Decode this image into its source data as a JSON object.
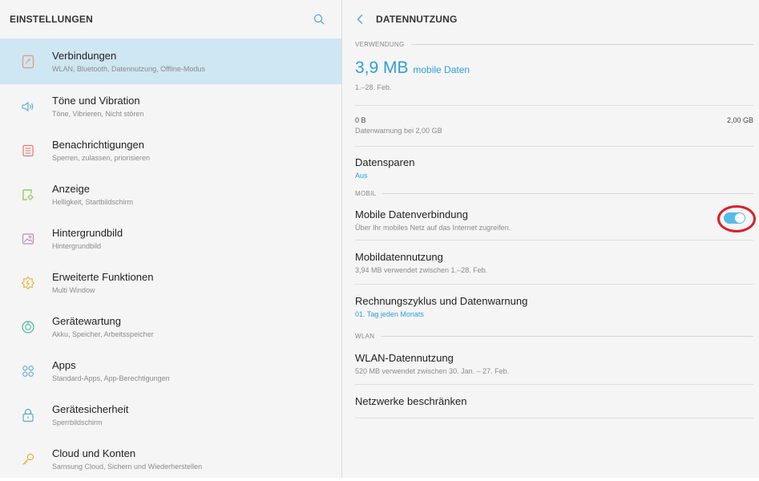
{
  "left": {
    "title": "EINSTELLUNGEN",
    "items": [
      {
        "title": "Verbindungen",
        "sub": "WLAN, Bluetooth, Datennutzung, Offline-Modus",
        "icon": "connections-icon"
      },
      {
        "title": "Töne und Vibration",
        "sub": "Töne, Vibrieren, Nicht stören",
        "icon": "speaker-icon"
      },
      {
        "title": "Benachrichtigungen",
        "sub": "Sperren, zulassen, priorisieren",
        "icon": "notifications-icon"
      },
      {
        "title": "Anzeige",
        "sub": "Helligkeit, Startbildschirm",
        "icon": "display-icon"
      },
      {
        "title": "Hintergrundbild",
        "sub": "Hintergrundbild",
        "icon": "wallpaper-icon"
      },
      {
        "title": "Erweiterte Funktionen",
        "sub": "Multi Window",
        "icon": "advanced-features-icon"
      },
      {
        "title": "Gerätewartung",
        "sub": "Akku, Speicher, Arbeitsspeicher",
        "icon": "device-maintenance-icon"
      },
      {
        "title": "Apps",
        "sub": "Standard-Apps, App-Berechtigungen",
        "icon": "apps-icon"
      },
      {
        "title": "Gerätesicherheit",
        "sub": "Sperrbildschirm",
        "icon": "lock-icon"
      },
      {
        "title": "Cloud und Konten",
        "sub": "Samsung Cloud, Sichern und Wiederherstellen",
        "icon": "key-icon"
      }
    ]
  },
  "right": {
    "title": "DATENNUTZUNG",
    "usage": {
      "label": "VERWENDUNG",
      "amount": "3,9 MB",
      "unit": "mobile Daten",
      "period": "1.–28. Feb."
    },
    "limit": {
      "min": "0 B",
      "max": "2,00 GB",
      "warning": "Datenwarnung bei 2,00 GB"
    },
    "datensparen": {
      "title": "Datensparen",
      "status": "Aus"
    },
    "mobil": {
      "label": "MOBIL",
      "mobile_connection": {
        "title": "Mobile Datenverbindung",
        "sub": "Über Ihr mobiles Netz auf das Internet zugreifen.",
        "enabled": true
      },
      "mobile_usage": {
        "title": "Mobildatennutzung",
        "sub": "3,94 MB verwendet zwischen 1.–28. Feb."
      },
      "billing": {
        "title": "Rechnungszyklus und Datenwarnung",
        "sub": "01. Tag jeden Monats"
      }
    },
    "wlan": {
      "label": "WLAN",
      "usage": {
        "title": "WLAN-Datennutzung",
        "sub": "520 MB verwendet zwischen 30. Jan. – 27. Feb."
      },
      "restrict": {
        "title": "Netzwerke beschränken"
      }
    }
  },
  "colors": {
    "accent": "#2f9fd6",
    "selected": "#cfe6f3",
    "annotation": "#d8202a",
    "icon": "#e8a07a"
  }
}
